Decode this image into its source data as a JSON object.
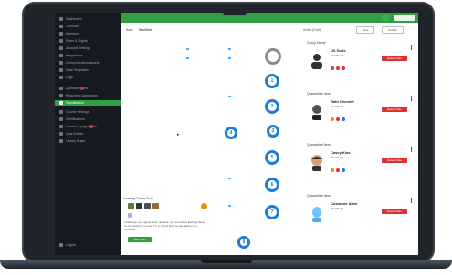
{
  "sidebar": {
    "items": [
      {
        "label": "Dashboard"
      },
      {
        "label": "Overview"
      },
      {
        "label": "Members"
      },
      {
        "label": "Roles & Rights"
      },
      {
        "label": "Account Settings"
      },
      {
        "label": "Integrations"
      },
      {
        "label": "Communication Assets"
      },
      {
        "label": "Data Templates"
      },
      {
        "label": "Logs"
      },
      {
        "label": "Questionnaires"
      },
      {
        "label": "Recurring Campaigns"
      },
      {
        "label": "Gamification"
      },
      {
        "label": "Course Settings"
      },
      {
        "label": "Certifications"
      },
      {
        "label": "Content Assignments"
      },
      {
        "label": "Quiz Builder"
      },
      {
        "label": "Library Rules"
      }
    ],
    "bottom_label": "Logout"
  },
  "toolbar": {
    "back_label": "Back",
    "title": "Workflow",
    "status_label": "Active (Draft)",
    "save_label": "Save",
    "publish_label": "Publish"
  },
  "canvas": {
    "steps": [
      {
        "label": ""
      },
      {
        "label": "1"
      },
      {
        "label": "2"
      },
      {
        "label": "3"
      },
      {
        "label": "4"
      },
      {
        "label": "5"
      },
      {
        "label": "6"
      },
      {
        "label": "7"
      },
      {
        "label": "8"
      }
    ],
    "tool_panel": {
      "title": "Learning Center Tools",
      "description": "Challenge your agent! Each question you set will be flashing based on the customer's tone. Try to mimic like you are talking to a customer.",
      "button_label": "Start Quiz"
    }
  },
  "right_panel": {
    "cards": [
      {
        "header": "Group Name",
        "name": "UX Dude",
        "sub": "40 000 XP",
        "button": "Delete Role"
      },
      {
        "header": "Quarantine Item",
        "name": "Bald Chemist",
        "sub": "42 737 XP",
        "button": "Delete Role"
      },
      {
        "header": "Quarantine Item",
        "name": "Casey Kiss",
        "sub": "38 034 XP",
        "button": "Delete Role"
      },
      {
        "header": "Quarantine Item",
        "name": "Customer Alien",
        "sub": "36 905 XP",
        "button": "Delete Role"
      }
    ]
  },
  "colors": {
    "brand_green": "#2f9e44",
    "step_blue": "#1c7ed6",
    "alert_red": "#e03131",
    "sidebar_bg": "#141a1f"
  }
}
